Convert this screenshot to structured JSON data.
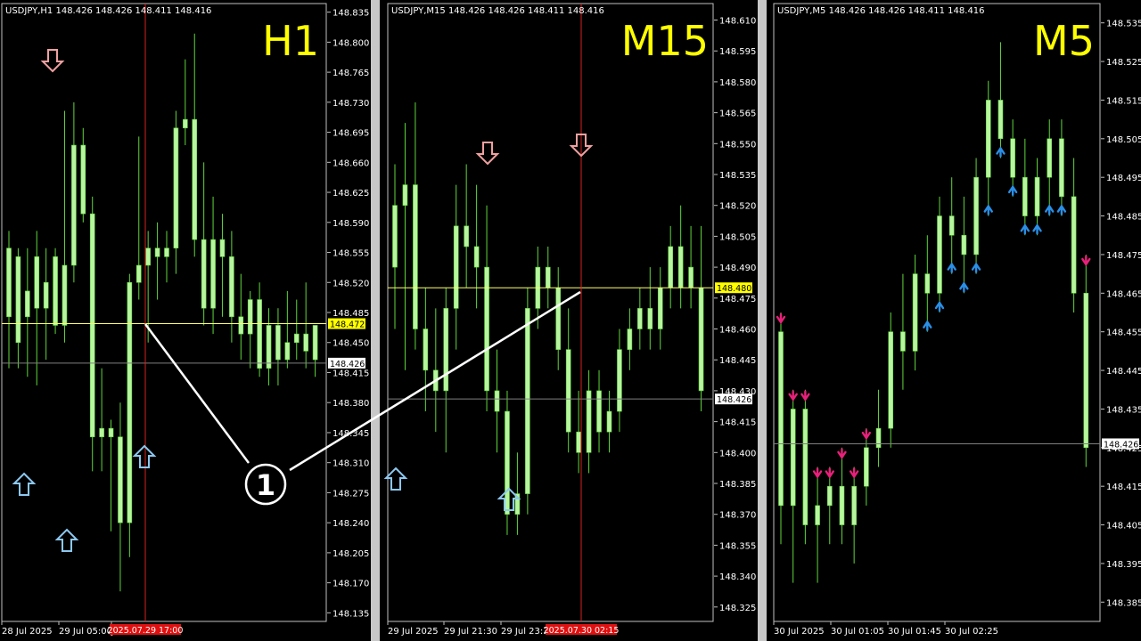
{
  "colors": {
    "background": "#000000",
    "candle": "#b8f5a0",
    "wick": "#5fd63a",
    "bid_line": "#ffff66",
    "price_line": "#808080",
    "cursor_line": "#d82020",
    "timeframe_label": "#ffff00",
    "arrow_up": "#8cc8f0",
    "arrow_down": "#f0a0a0",
    "signal_up": "#2a8fe6",
    "signal_down": "#e8207a",
    "annotation": "#ffffff"
  },
  "annotation": {
    "marker": "1"
  },
  "panels": [
    {
      "id": "h1",
      "header": "USDJPY,H1  148.426 148.426 148.411 148.416",
      "timeframe": "H1",
      "bid_tag": "148.472",
      "price_tag": "148.426",
      "cursor_time": "2025.07.29 17:00",
      "y_ticks": [
        "148.835",
        "148.800",
        "148.765",
        "148.730",
        "148.695",
        "148.660",
        "148.625",
        "148.590",
        "148.555",
        "148.520",
        "148.485",
        "148.450",
        "148.415",
        "148.380",
        "148.345",
        "148.310",
        "148.275",
        "148.240",
        "148.205",
        "148.170",
        "148.135"
      ],
      "x_ticks": [
        "28 Jul 2025",
        "29 Jul 05:00",
        "Jul 21:00"
      ]
    },
    {
      "id": "m15",
      "header": "USDJPY,M15  148.426 148.426 148.411 148.416",
      "timeframe": "M15",
      "bid_tag": "148.480",
      "price_tag": "148.426",
      "cursor_time": "2025.07.30 02:15",
      "y_ticks": [
        "148.610",
        "148.595",
        "148.580",
        "148.565",
        "148.550",
        "148.535",
        "148.520",
        "148.505",
        "148.490",
        "148.475",
        "148.460",
        "148.445",
        "148.430",
        "148.415",
        "148.400",
        "148.385",
        "148.370",
        "148.355",
        "148.340",
        "148.325"
      ],
      "x_ticks": [
        "29 Jul 2025",
        "29 Jul 21:30",
        "29 Jul 23:30"
      ]
    },
    {
      "id": "m5",
      "header": "USDJPY,M5  148.426 148.426 148.411 148.416",
      "timeframe": "M5",
      "bid_tag": "",
      "price_tag": "148.426",
      "cursor_time": "",
      "y_ticks": [
        "148.535",
        "148.525",
        "148.515",
        "148.505",
        "148.495",
        "148.485",
        "148.475",
        "148.465",
        "148.455",
        "148.445",
        "148.435",
        "148.425",
        "148.415",
        "148.405",
        "148.395",
        "148.385"
      ],
      "x_ticks": [
        "30 Jul 2025",
        "30 Jul 01:05",
        "30 Jul 01:45",
        "30 Jul 02:25"
      ]
    }
  ],
  "chart_data": [
    {
      "type": "candlestick",
      "symbol": "USDJPY",
      "timeframe": "H1",
      "ylim": [
        148.125,
        148.845
      ],
      "bid_line": 148.472,
      "last_price_line": 148.426,
      "candles": [
        {
          "o": 148.56,
          "h": 148.58,
          "l": 148.42,
          "c": 148.48
        },
        {
          "o": 148.45,
          "h": 148.56,
          "l": 148.42,
          "c": 148.55
        },
        {
          "o": 148.48,
          "h": 148.56,
          "l": 148.41,
          "c": 148.51
        },
        {
          "o": 148.55,
          "h": 148.58,
          "l": 148.4,
          "c": 148.49
        },
        {
          "o": 148.49,
          "h": 148.56,
          "l": 148.43,
          "c": 148.52
        },
        {
          "o": 148.55,
          "h": 148.56,
          "l": 148.46,
          "c": 148.47
        },
        {
          "o": 148.47,
          "h": 148.72,
          "l": 148.45,
          "c": 148.54
        },
        {
          "o": 148.54,
          "h": 148.73,
          "l": 148.52,
          "c": 148.68
        },
        {
          "o": 148.68,
          "h": 148.7,
          "l": 148.59,
          "c": 148.6
        },
        {
          "o": 148.6,
          "h": 148.62,
          "l": 148.3,
          "c": 148.34
        },
        {
          "o": 148.34,
          "h": 148.42,
          "l": 148.3,
          "c": 148.35
        },
        {
          "o": 148.35,
          "h": 148.36,
          "l": 148.23,
          "c": 148.34
        },
        {
          "o": 148.34,
          "h": 148.38,
          "l": 148.16,
          "c": 148.24
        },
        {
          "o": 148.24,
          "h": 148.53,
          "l": 148.2,
          "c": 148.52
        },
        {
          "o": 148.52,
          "h": 148.69,
          "l": 148.5,
          "c": 148.54
        },
        {
          "o": 148.54,
          "h": 148.58,
          "l": 148.45,
          "c": 148.56
        },
        {
          "o": 148.56,
          "h": 148.59,
          "l": 148.5,
          "c": 148.55
        },
        {
          "o": 148.55,
          "h": 148.58,
          "l": 148.52,
          "c": 148.56
        },
        {
          "o": 148.56,
          "h": 148.72,
          "l": 148.53,
          "c": 148.7
        },
        {
          "o": 148.7,
          "h": 148.78,
          "l": 148.68,
          "c": 148.71
        },
        {
          "o": 148.71,
          "h": 148.81,
          "l": 148.55,
          "c": 148.57
        },
        {
          "o": 148.57,
          "h": 148.66,
          "l": 148.47,
          "c": 148.49
        },
        {
          "o": 148.49,
          "h": 148.62,
          "l": 148.46,
          "c": 148.57
        },
        {
          "o": 148.57,
          "h": 148.6,
          "l": 148.48,
          "c": 148.55
        },
        {
          "o": 148.55,
          "h": 148.58,
          "l": 148.45,
          "c": 148.48
        },
        {
          "o": 148.48,
          "h": 148.53,
          "l": 148.43,
          "c": 148.46
        },
        {
          "o": 148.46,
          "h": 148.51,
          "l": 148.42,
          "c": 148.5
        },
        {
          "o": 148.5,
          "h": 148.52,
          "l": 148.41,
          "c": 148.42
        },
        {
          "o": 148.42,
          "h": 148.49,
          "l": 148.4,
          "c": 148.47
        },
        {
          "o": 148.47,
          "h": 148.49,
          "l": 148.4,
          "c": 148.43
        },
        {
          "o": 148.43,
          "h": 148.51,
          "l": 148.42,
          "c": 148.45
        },
        {
          "o": 148.45,
          "h": 148.5,
          "l": 148.43,
          "c": 148.46
        },
        {
          "o": 148.46,
          "h": 148.52,
          "l": 148.42,
          "c": 148.44
        },
        {
          "o": 148.43,
          "h": 148.47,
          "l": 148.41,
          "c": 148.47
        }
      ]
    },
    {
      "type": "candlestick",
      "symbol": "USDJPY",
      "timeframe": "M15",
      "ylim": [
        148.318,
        148.618
      ],
      "bid_line": 148.48,
      "last_price_line": 148.426,
      "candles": [
        {
          "o": 148.49,
          "h": 148.54,
          "l": 148.46,
          "c": 148.52
        },
        {
          "o": 148.52,
          "h": 148.56,
          "l": 148.44,
          "c": 148.53
        },
        {
          "o": 148.53,
          "h": 148.57,
          "l": 148.45,
          "c": 148.46
        },
        {
          "o": 148.46,
          "h": 148.48,
          "l": 148.42,
          "c": 148.44
        },
        {
          "o": 148.44,
          "h": 148.47,
          "l": 148.41,
          "c": 148.43
        },
        {
          "o": 148.43,
          "h": 148.48,
          "l": 148.4,
          "c": 148.47
        },
        {
          "o": 148.47,
          "h": 148.53,
          "l": 148.45,
          "c": 148.51
        },
        {
          "o": 148.51,
          "h": 148.54,
          "l": 148.48,
          "c": 148.5
        },
        {
          "o": 148.5,
          "h": 148.53,
          "l": 148.47,
          "c": 148.49
        },
        {
          "o": 148.49,
          "h": 148.52,
          "l": 148.42,
          "c": 148.43
        },
        {
          "o": 148.43,
          "h": 148.45,
          "l": 148.4,
          "c": 148.42
        },
        {
          "o": 148.42,
          "h": 148.43,
          "l": 148.36,
          "c": 148.37
        },
        {
          "o": 148.37,
          "h": 148.4,
          "l": 148.36,
          "c": 148.38
        },
        {
          "o": 148.38,
          "h": 148.48,
          "l": 148.37,
          "c": 148.47
        },
        {
          "o": 148.47,
          "h": 148.5,
          "l": 148.46,
          "c": 148.49
        },
        {
          "o": 148.49,
          "h": 148.5,
          "l": 148.47,
          "c": 148.48
        },
        {
          "o": 148.48,
          "h": 148.49,
          "l": 148.44,
          "c": 148.45
        },
        {
          "o": 148.45,
          "h": 148.47,
          "l": 148.4,
          "c": 148.41
        },
        {
          "o": 148.41,
          "h": 148.43,
          "l": 148.39,
          "c": 148.4
        },
        {
          "o": 148.4,
          "h": 148.44,
          "l": 148.39,
          "c": 148.43
        },
        {
          "o": 148.43,
          "h": 148.44,
          "l": 148.4,
          "c": 148.41
        },
        {
          "o": 148.41,
          "h": 148.43,
          "l": 148.4,
          "c": 148.42
        },
        {
          "o": 148.42,
          "h": 148.46,
          "l": 148.41,
          "c": 148.45
        },
        {
          "o": 148.45,
          "h": 148.47,
          "l": 148.44,
          "c": 148.46
        },
        {
          "o": 148.46,
          "h": 148.48,
          "l": 148.45,
          "c": 148.47
        },
        {
          "o": 148.47,
          "h": 148.49,
          "l": 148.45,
          "c": 148.46
        },
        {
          "o": 148.46,
          "h": 148.49,
          "l": 148.45,
          "c": 148.48
        },
        {
          "o": 148.48,
          "h": 148.51,
          "l": 148.47,
          "c": 148.5
        },
        {
          "o": 148.5,
          "h": 148.52,
          "l": 148.47,
          "c": 148.48
        },
        {
          "o": 148.48,
          "h": 148.51,
          "l": 148.47,
          "c": 148.49
        },
        {
          "o": 148.48,
          "h": 148.51,
          "l": 148.42,
          "c": 148.43
        }
      ]
    },
    {
      "type": "candlestick",
      "symbol": "USDJPY",
      "timeframe": "M5",
      "ylim": [
        148.38,
        148.54
      ],
      "last_price_line": 148.426,
      "candles": [
        {
          "o": 148.455,
          "h": 148.46,
          "l": 148.4,
          "c": 148.41
        },
        {
          "o": 148.41,
          "h": 148.44,
          "l": 148.39,
          "c": 148.435
        },
        {
          "o": 148.435,
          "h": 148.44,
          "l": 148.4,
          "c": 148.405
        },
        {
          "o": 148.405,
          "h": 148.42,
          "l": 148.39,
          "c": 148.41
        },
        {
          "o": 148.41,
          "h": 148.42,
          "l": 148.4,
          "c": 148.415
        },
        {
          "o": 148.415,
          "h": 148.425,
          "l": 148.4,
          "c": 148.405
        },
        {
          "o": 148.405,
          "h": 148.42,
          "l": 148.395,
          "c": 148.415
        },
        {
          "o": 148.415,
          "h": 148.43,
          "l": 148.41,
          "c": 148.425
        },
        {
          "o": 148.425,
          "h": 148.44,
          "l": 148.42,
          "c": 148.43
        },
        {
          "o": 148.43,
          "h": 148.46,
          "l": 148.425,
          "c": 148.455
        },
        {
          "o": 148.455,
          "h": 148.47,
          "l": 148.44,
          "c": 148.45
        },
        {
          "o": 148.45,
          "h": 148.475,
          "l": 148.445,
          "c": 148.47
        },
        {
          "o": 148.47,
          "h": 148.48,
          "l": 148.455,
          "c": 148.465
        },
        {
          "o": 148.465,
          "h": 148.49,
          "l": 148.46,
          "c": 148.485
        },
        {
          "o": 148.485,
          "h": 148.495,
          "l": 148.47,
          "c": 148.48
        },
        {
          "o": 148.48,
          "h": 148.49,
          "l": 148.465,
          "c": 148.475
        },
        {
          "o": 148.475,
          "h": 148.5,
          "l": 148.47,
          "c": 148.495
        },
        {
          "o": 148.495,
          "h": 148.52,
          "l": 148.485,
          "c": 148.515
        },
        {
          "o": 148.515,
          "h": 148.53,
          "l": 148.5,
          "c": 148.505
        },
        {
          "o": 148.505,
          "h": 148.51,
          "l": 148.49,
          "c": 148.495
        },
        {
          "o": 148.495,
          "h": 148.505,
          "l": 148.48,
          "c": 148.485
        },
        {
          "o": 148.485,
          "h": 148.5,
          "l": 148.48,
          "c": 148.495
        },
        {
          "o": 148.495,
          "h": 148.51,
          "l": 148.485,
          "c": 148.505
        },
        {
          "o": 148.505,
          "h": 148.51,
          "l": 148.485,
          "c": 148.49
        },
        {
          "o": 148.49,
          "h": 148.5,
          "l": 148.46,
          "c": 148.465
        },
        {
          "o": 148.465,
          "h": 148.475,
          "l": 148.42,
          "c": 148.425
        }
      ],
      "signals": [
        {
          "side": "down",
          "i": 0
        },
        {
          "side": "down",
          "i": 1
        },
        {
          "side": "down",
          "i": 2
        },
        {
          "side": "down",
          "i": 3
        },
        {
          "side": "down",
          "i": 4
        },
        {
          "side": "down",
          "i": 5
        },
        {
          "side": "down",
          "i": 6
        },
        {
          "side": "down",
          "i": 7
        },
        {
          "side": "up",
          "i": 12
        },
        {
          "side": "up",
          "i": 13
        },
        {
          "side": "up",
          "i": 14
        },
        {
          "side": "up",
          "i": 15
        },
        {
          "side": "up",
          "i": 16
        },
        {
          "side": "up",
          "i": 17
        },
        {
          "side": "up",
          "i": 18
        },
        {
          "side": "up",
          "i": 19
        },
        {
          "side": "up",
          "i": 20
        },
        {
          "side": "up",
          "i": 21
        },
        {
          "side": "up",
          "i": 22
        },
        {
          "side": "up",
          "i": 23
        },
        {
          "side": "down",
          "i": 25
        }
      ]
    }
  ]
}
